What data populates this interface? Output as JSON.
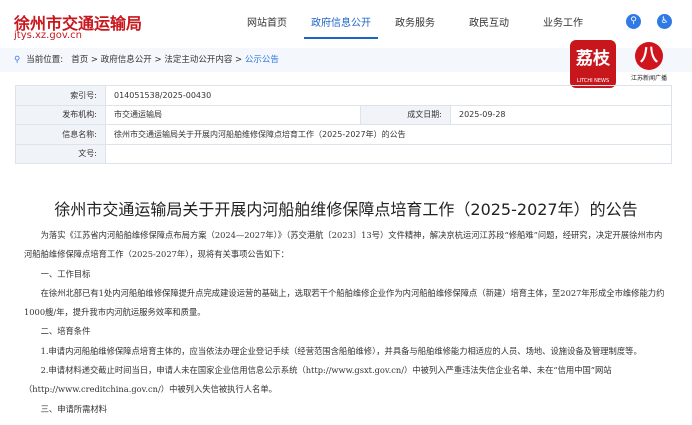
{
  "header": {
    "title": "徐州市交通运输局",
    "domain": "jtys.xz.gov.cn",
    "nav": [
      "网站首页",
      "政府信息公开",
      "政务服务",
      "政民互动",
      "业务工作"
    ],
    "active": 1
  },
  "breadcrumb": {
    "label": "当前位置:",
    "items": [
      "首页",
      "政府信息公开",
      "法定主动公开内容"
    ],
    "current": "公示公告"
  },
  "badges": {
    "litchi": "荔枝",
    "litchi_sub": "LITCHI NEWS",
    "jsb_sub": "江苏新闻广播"
  },
  "meta": {
    "index_label": "索引号:",
    "index": "014051538/2025-00430",
    "org_label": "发布机构:",
    "org": "市交通运输局",
    "date_label": "成文日期:",
    "date": "2025-09-28",
    "name_label": "信息名称:",
    "name": "徐州市交通运输局关于开展内河船舶维修保障点培育工作（2025-2027年）的公告",
    "docno_label": "文号:",
    "docno": ""
  },
  "article": {
    "title": "徐州市交通运输局关于开展内河船舶维修保障点培育工作（2025-2027年）的公告",
    "paragraphs": [
      "为落实《江苏省内河船舶维修保障点布局方案（2024—2027年）》（苏交港航〔2023〕13号）文件精神，解决京杭运河江苏段“修船难”问题，经研究，决定开展徐州市内河船舶维修保障点培育工作（2025-2027年），现将有关事项公告如下：",
      "一、工作目标",
      "在徐州北部已有1处内河船舶维修保障提升点完成建设运营的基础上，选取若干个船舶维修企业作为内河船舶维修保障点（新建）培育主体，至2027年形成全市维修能力约1000艘/年，提升我市内河航运服务效率和质量。",
      "二、培育条件",
      "1.申请内河船舶维修保障点培育主体的，应当依法办理企业登记手续（经营范围含船舶维修），并具备与船舶维修能力相适应的人员、场地、设施设备及管理制度等。",
      "2.申请材料递交截止时间当日，申请人未在国家企业信用信息公示系统（http://www.gsxt.gov.cn/）中被列入严重违法失信企业名单、未在“信用中国”网站（http://www.creditchina.gov.cn/）中被列入失信被执行人名单。",
      "三、申请所需材料"
    ]
  }
}
